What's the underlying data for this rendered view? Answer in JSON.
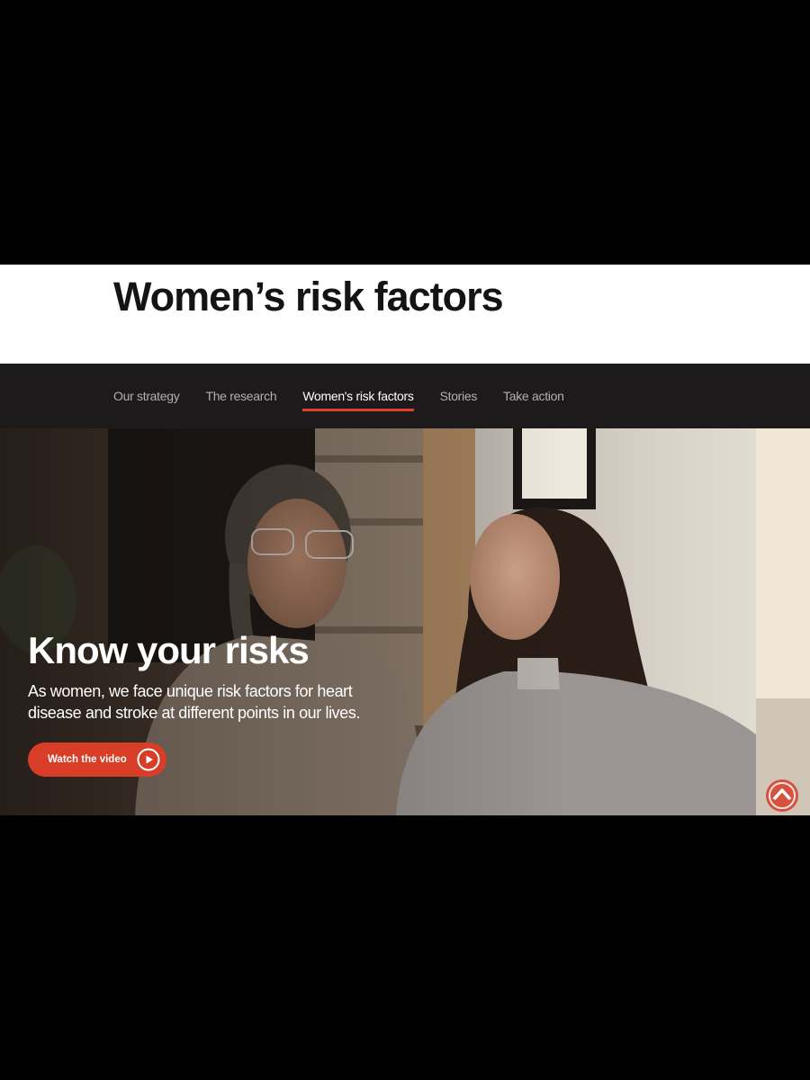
{
  "header": {
    "title": "Women’s risk factors"
  },
  "nav": {
    "items": [
      {
        "label": "Our strategy",
        "active": false
      },
      {
        "label": "The research",
        "active": false
      },
      {
        "label": "Women's risk factors",
        "active": true
      },
      {
        "label": "Stories",
        "active": false
      },
      {
        "label": "Take action",
        "active": false
      }
    ]
  },
  "hero": {
    "heading": "Know your risks",
    "body": "As women, we face unique risk factors for heart disease and stroke at different points in our lives.",
    "button_label": "Watch the video",
    "icons": {
      "play": "play-icon",
      "scroll_top": "chevron-up-icon"
    }
  },
  "colors": {
    "accent": "#d83d28",
    "nav_background": "#1d1a1b",
    "title_text": "#141414"
  }
}
